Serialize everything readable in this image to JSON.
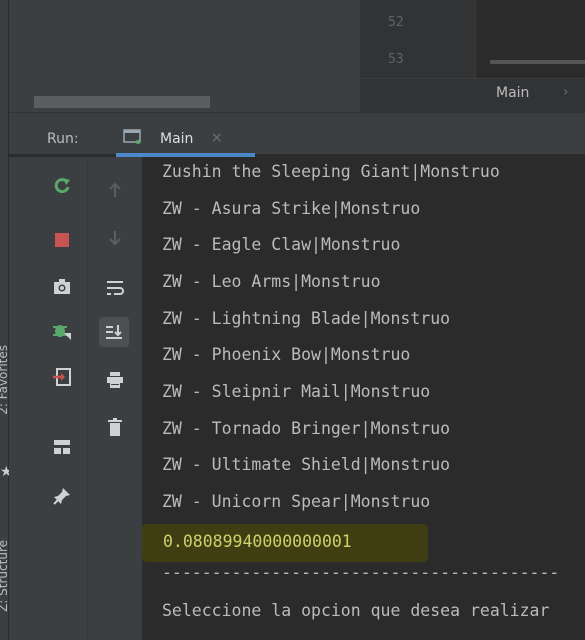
{
  "editor": {
    "line_numbers": [
      "52",
      "53"
    ],
    "breadcrumb": "Main",
    "breadcrumb_sep": "›"
  },
  "run": {
    "label": "Run:",
    "tab_label": "Main",
    "tab_close": "×"
  },
  "left_stripe": {
    "favorites": "2: Favorites",
    "structure": "Z: Structure"
  },
  "console": {
    "lines": [
      "Zushin the Sleeping Giant|Monstruo",
      "ZW - Asura Strike|Monstruo",
      "ZW - Eagle Claw|Monstruo",
      "ZW - Leo Arms|Monstruo",
      "ZW - Lightning Blade|Monstruo",
      "ZW - Phoenix Bow|Monstruo",
      "ZW - Sleipnir Mail|Monstruo",
      "ZW - Tornado Bringer|Monstruo",
      "ZW - Ultimate Shield|Monstruo",
      "ZW - Unicorn Spear|Monstruo"
    ],
    "result": "0.08089940000000001",
    "separator": "----------------------------------------",
    "prompt": "Seleccione la opcion que desea realizar"
  },
  "colors": {
    "accent": "#4a88c7",
    "rerun_green": "#59a869",
    "stop_red": "#c75450",
    "highlight_bg": "#3e3e12"
  }
}
